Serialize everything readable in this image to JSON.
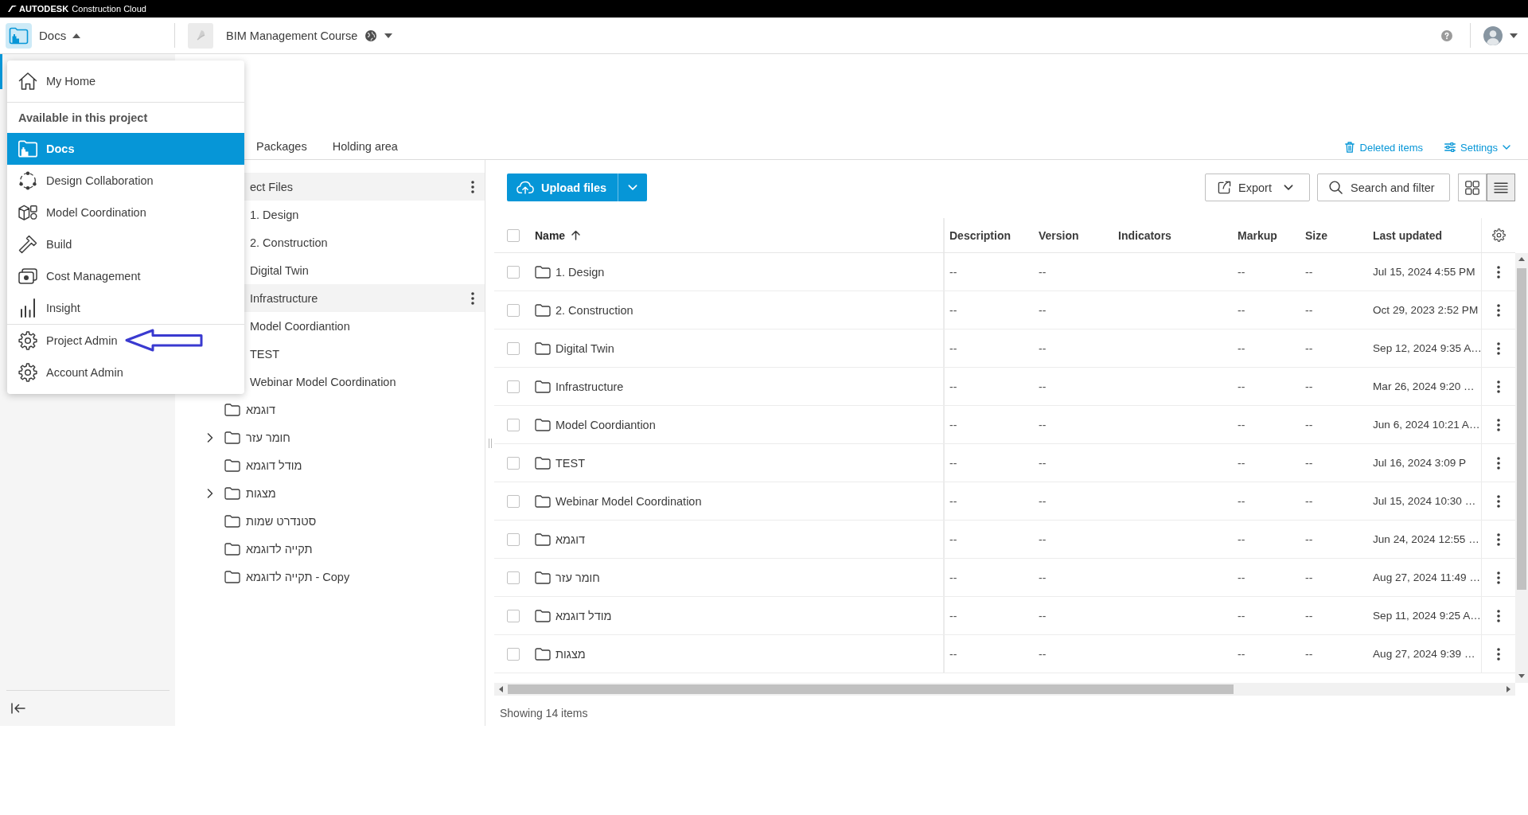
{
  "top_bar": {
    "brand": "AUTODESK",
    "product": "Construction Cloud"
  },
  "header": {
    "app": "Docs",
    "project": "BIM Management Course"
  },
  "app_menu": {
    "open": true,
    "home": "My Home",
    "section_title": "Available in this project",
    "items": [
      {
        "label": "Docs",
        "selected": true
      },
      {
        "label": "Design Collaboration",
        "selected": false
      },
      {
        "label": "Model Coordination",
        "selected": false
      },
      {
        "label": "Build",
        "selected": false
      },
      {
        "label": "Cost Management",
        "selected": false
      },
      {
        "label": "Insight",
        "selected": false
      }
    ],
    "admin_items": [
      {
        "label": "Project Admin",
        "selected": false
      },
      {
        "label": "Account Admin",
        "selected": false
      }
    ]
  },
  "tabs": [
    {
      "label": "Packages",
      "selected": false
    },
    {
      "label": "Holding area",
      "selected": false
    }
  ],
  "links": {
    "deleted_items": "Deleted items",
    "settings": "Settings"
  },
  "tree": {
    "root": {
      "label": "ect Files",
      "highlighted": true,
      "children": [
        {
          "label": "1. Design",
          "highlighted": false
        },
        {
          "label": "2. Construction",
          "highlighted": false
        },
        {
          "label": "Digital Twin",
          "highlighted": false
        },
        {
          "label": "Infrastructure",
          "highlighted": true
        },
        {
          "label": "Model Coordiantion",
          "highlighted": false
        },
        {
          "label": "TEST",
          "highlighted": false
        },
        {
          "label": "Webinar Model Coordination",
          "highlighted": false
        },
        {
          "label": "דוגמא",
          "highlighted": false
        },
        {
          "label": "חומר עזר",
          "highlighted": false,
          "expanded": false
        },
        {
          "label": "מודל דוגמא",
          "highlighted": false
        },
        {
          "label": "מצגות",
          "highlighted": false,
          "expanded": false
        },
        {
          "label": "סטנדרט שמות",
          "highlighted": false
        },
        {
          "label": "תקייה לדוגמא",
          "highlighted": false
        },
        {
          "label": "תקייה לדוגמא - Copy",
          "highlighted": false
        }
      ]
    }
  },
  "toolbar": {
    "upload": "Upload files",
    "export": "Export",
    "search": "Search and filter",
    "views": [
      {
        "kind": "grid",
        "selected": false
      },
      {
        "kind": "list",
        "selected": true
      }
    ]
  },
  "table": {
    "all_checked": false,
    "columns": [
      {
        "label": "Name",
        "sorted": true,
        "descending": false
      },
      {
        "label": "Description",
        "sorted": false
      },
      {
        "label": "Version",
        "sorted": false
      },
      {
        "label": "Indicators",
        "sorted": false
      },
      {
        "label": "Markup",
        "sorted": false
      },
      {
        "label": "Size",
        "sorted": false
      },
      {
        "label": "Last updated",
        "sorted": false
      }
    ],
    "rows": [
      {
        "checked": false,
        "name": "1. Design",
        "description": "--",
        "version": "--",
        "markup": "--",
        "size": "--",
        "last_updated": "Jul 15, 2024 4:55 PM"
      },
      {
        "checked": false,
        "name": "2. Construction",
        "description": "--",
        "version": "--",
        "markup": "--",
        "size": "--",
        "last_updated": "Oct 29, 2023 2:52 PM"
      },
      {
        "checked": false,
        "name": "Digital Twin",
        "description": "--",
        "version": "--",
        "markup": "--",
        "size": "--",
        "last_updated": "Sep 12, 2024 9:35 A…"
      },
      {
        "checked": false,
        "name": "Infrastructure",
        "description": "--",
        "version": "--",
        "markup": "--",
        "size": "--",
        "last_updated": "Mar 26, 2024 9:20 …"
      },
      {
        "checked": false,
        "name": "Model Coordiantion",
        "description": "--",
        "version": "--",
        "markup": "--",
        "size": "--",
        "last_updated": "Jun 6, 2024 10:21 A…"
      },
      {
        "checked": false,
        "name": "TEST",
        "description": "--",
        "version": "--",
        "markup": "--",
        "size": "--",
        "last_updated": "Jul 16, 2024 3:09 P"
      },
      {
        "checked": false,
        "name": "Webinar Model Coordination",
        "description": "--",
        "version": "--",
        "markup": "--",
        "size": "--",
        "last_updated": "Jul 15, 2024 10:30 …"
      },
      {
        "checked": false,
        "name": "דוגמא",
        "description": "--",
        "version": "--",
        "markup": "--",
        "size": "--",
        "last_updated": "Jun 24, 2024 12:55 …"
      },
      {
        "checked": false,
        "name": "חומר עזר",
        "description": "--",
        "version": "--",
        "markup": "--",
        "size": "--",
        "last_updated": "Aug 27, 2024 11:49 …"
      },
      {
        "checked": false,
        "name": "מודל דוגמא",
        "description": "--",
        "version": "--",
        "markup": "--",
        "size": "--",
        "last_updated": "Sep 11, 2024 9:25 A…"
      },
      {
        "checked": false,
        "name": "מצגות",
        "description": "--",
        "version": "--",
        "markup": "--",
        "size": "--",
        "last_updated": "Aug 27, 2024 9:39 …"
      }
    ]
  },
  "status_bar": {
    "count": "Showing 14 items"
  }
}
